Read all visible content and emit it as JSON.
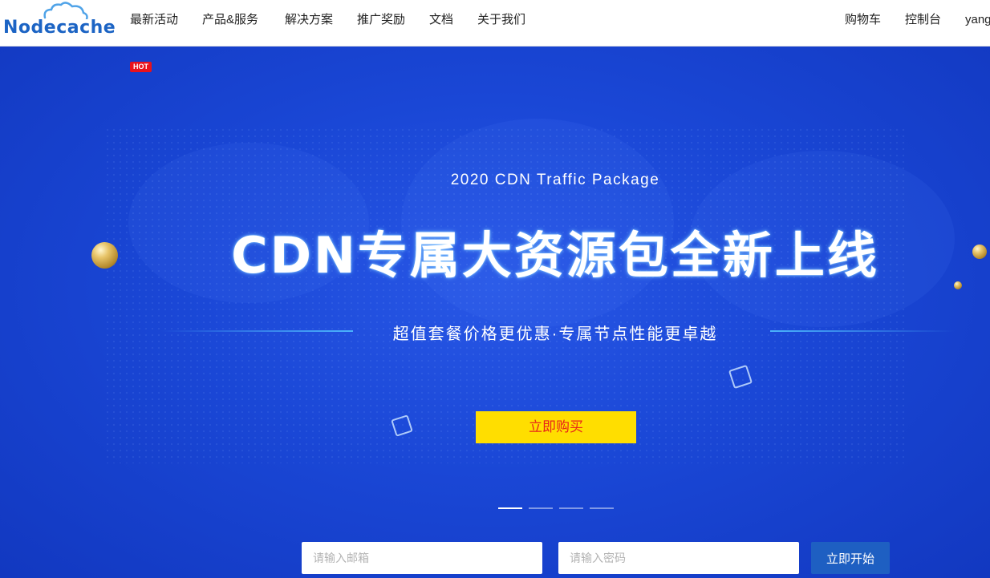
{
  "header": {
    "logo_text": "Nodecache",
    "nav": [
      "最新活动",
      "产品&服务",
      "解决方案",
      "推广奖励",
      "文档",
      "关于我们"
    ],
    "hot_badge": "HOT",
    "right": {
      "cart": "购物车",
      "console": "控制台",
      "user": "yang"
    }
  },
  "hero": {
    "subtitle": "2020 CDN Traffic Package",
    "title": "CDN专属大资源包全新上线",
    "tagline": "超值套餐价格更优惠·专属节点性能更卓越",
    "buy_button": "立即购买",
    "slides_total": 4,
    "slide_active": 1
  },
  "signup": {
    "email_placeholder": "请输入邮箱",
    "password_placeholder": "请输入密码",
    "start_button": "立即开始"
  },
  "colors": {
    "brand": "#1c64c4",
    "hero_bg": "#1a47d6",
    "buy_button_bg": "#ffde00",
    "buy_button_text": "#e8231a",
    "hot_badge": "#e8121c"
  }
}
